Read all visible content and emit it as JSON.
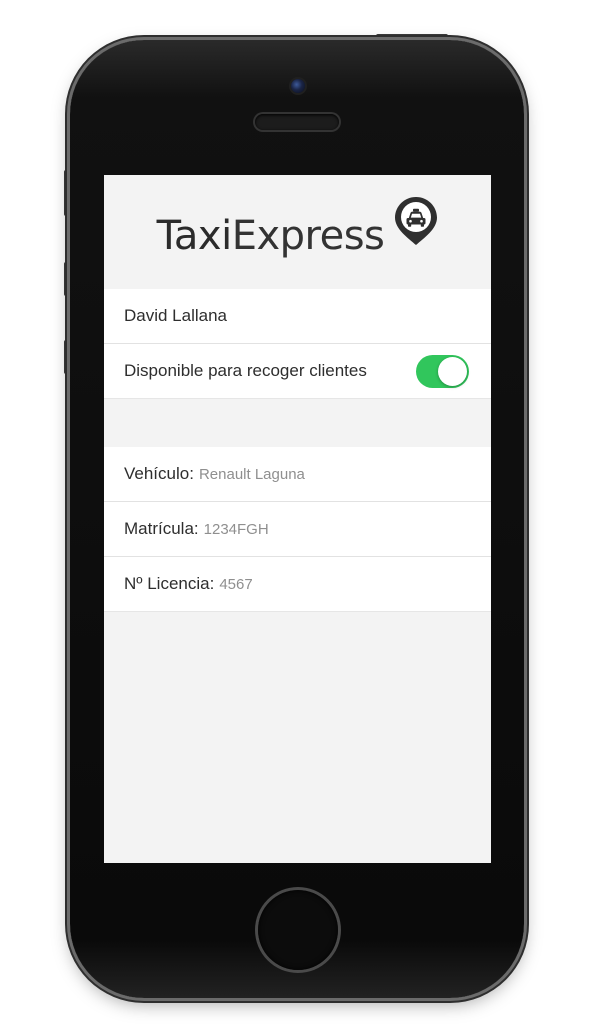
{
  "app": {
    "logo_part1": "Taxi",
    "logo_part2": "Express",
    "logo_icon": "taxi-pin-icon"
  },
  "driver": {
    "name": "David Lallana"
  },
  "availability": {
    "label": "Disponible para recoger clientes",
    "enabled": true
  },
  "vehicle_info": [
    {
      "label": "Vehículo:",
      "value": "Renault Laguna"
    },
    {
      "label": "Matrícula:",
      "value": "1234FGH"
    },
    {
      "label": "Nº Licencia:",
      "value": "4567"
    }
  ],
  "colors": {
    "toggle_on": "#31c65c",
    "screen_bg": "#f3f3f3",
    "value_text": "#8f8f8f"
  }
}
